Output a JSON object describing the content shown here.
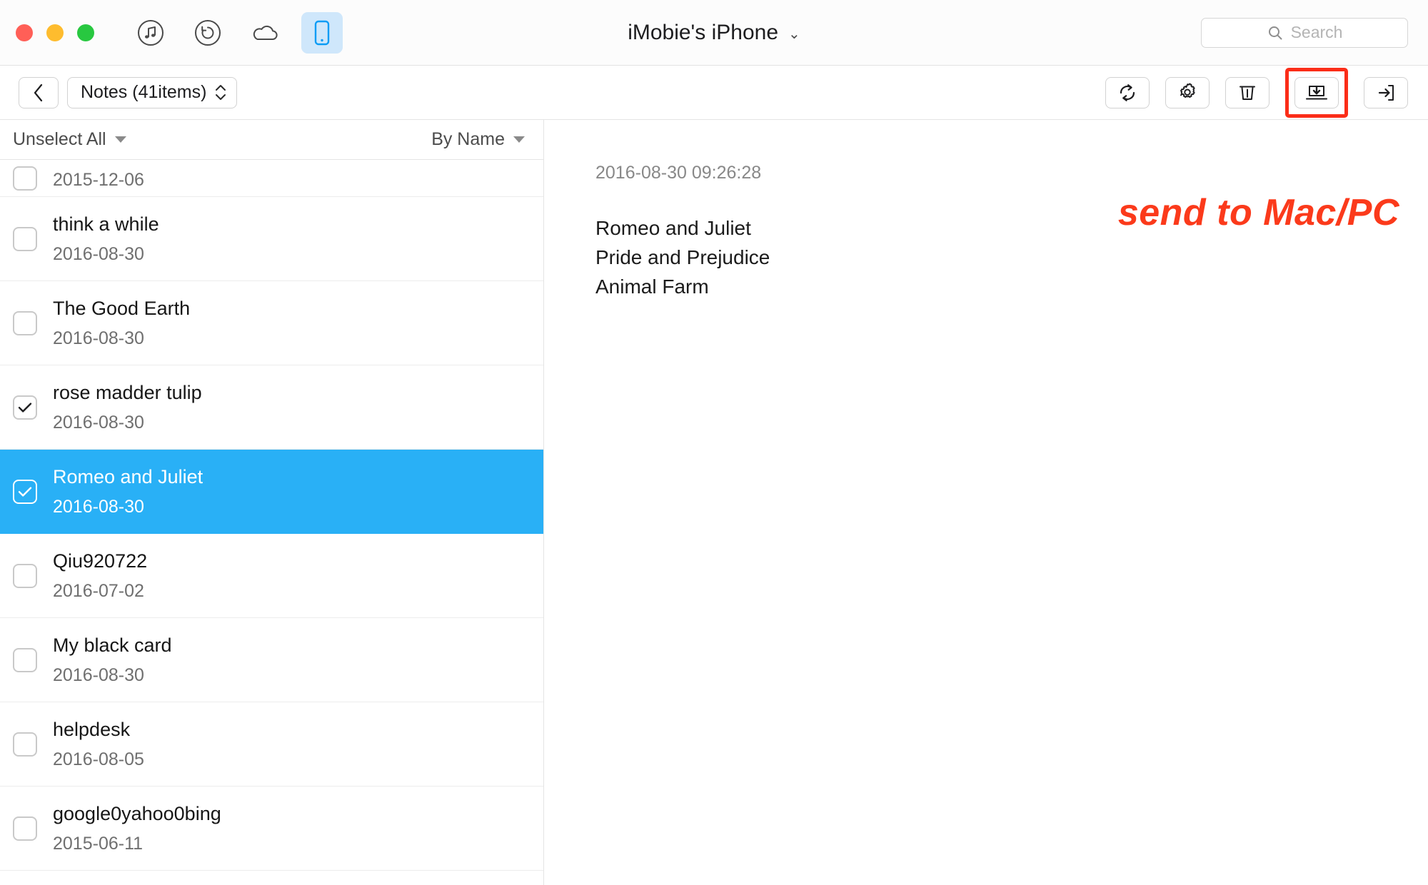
{
  "window": {
    "title": "iMobie's iPhone",
    "title_chevron": "chevron-down-icon",
    "traffic_lights": [
      "close",
      "minimize",
      "zoom"
    ],
    "toolbar_icons": [
      {
        "name": "music-icon",
        "active": false
      },
      {
        "name": "restore-history-icon",
        "active": false
      },
      {
        "name": "cloud-icon",
        "active": false
      },
      {
        "name": "device-phone-icon",
        "active": true
      }
    ]
  },
  "search": {
    "placeholder": "Search",
    "value": "",
    "icon": "search-icon"
  },
  "navbar": {
    "back_icon": "chevron-left-icon",
    "category_label": "Notes (41items)",
    "stepper_icon": "stepper-updown-icon",
    "actions": [
      {
        "name": "refresh-button",
        "icon": "refresh-icon",
        "highlighted": false
      },
      {
        "name": "settings-button",
        "icon": "gear-icon",
        "highlighted": false
      },
      {
        "name": "delete-button",
        "icon": "trash-icon",
        "highlighted": false
      },
      {
        "name": "export-to-computer-button",
        "icon": "export-to-mac-icon",
        "highlighted": true
      },
      {
        "name": "import-to-device-button",
        "icon": "import-to-device-icon",
        "highlighted": false
      }
    ]
  },
  "list_header": {
    "select_label": "Unselect All",
    "sort_label": "By Name"
  },
  "list_items": [
    {
      "title": "",
      "date": "2015-12-06",
      "checked": false,
      "selected": false,
      "clipped": true
    },
    {
      "title": "think a while",
      "date": "2016-08-30",
      "checked": false,
      "selected": false,
      "clipped": false
    },
    {
      "title": "The Good Earth",
      "date": "2016-08-30",
      "checked": false,
      "selected": false,
      "clipped": false
    },
    {
      "title": "rose madder tulip",
      "date": "2016-08-30",
      "checked": true,
      "selected": false,
      "clipped": false
    },
    {
      "title": "Romeo and Juliet",
      "date": "2016-08-30",
      "checked": true,
      "selected": true,
      "clipped": false
    },
    {
      "title": "Qiu920722",
      "date": "2016-07-02",
      "checked": false,
      "selected": false,
      "clipped": false
    },
    {
      "title": "My black card",
      "date": "2016-08-30",
      "checked": false,
      "selected": false,
      "clipped": false
    },
    {
      "title": "helpdesk",
      "date": "2016-08-05",
      "checked": false,
      "selected": false,
      "clipped": false
    },
    {
      "title": "google0yahoo0bing",
      "date": "2015-06-11",
      "checked": false,
      "selected": false,
      "clipped": false
    }
  ],
  "detail": {
    "timestamp": "2016-08-30 09:26:28",
    "lines": [
      "Romeo and Juliet",
      "Pride and Prejudice",
      "Animal Farm"
    ]
  },
  "annotation": {
    "text": "send to Mac/PC",
    "color": "#fb3a1b"
  },
  "colors": {
    "selection_blue": "#29b0f6",
    "highlight_red": "#fb2d18",
    "device_tab_bg": "#cfe7fb"
  }
}
